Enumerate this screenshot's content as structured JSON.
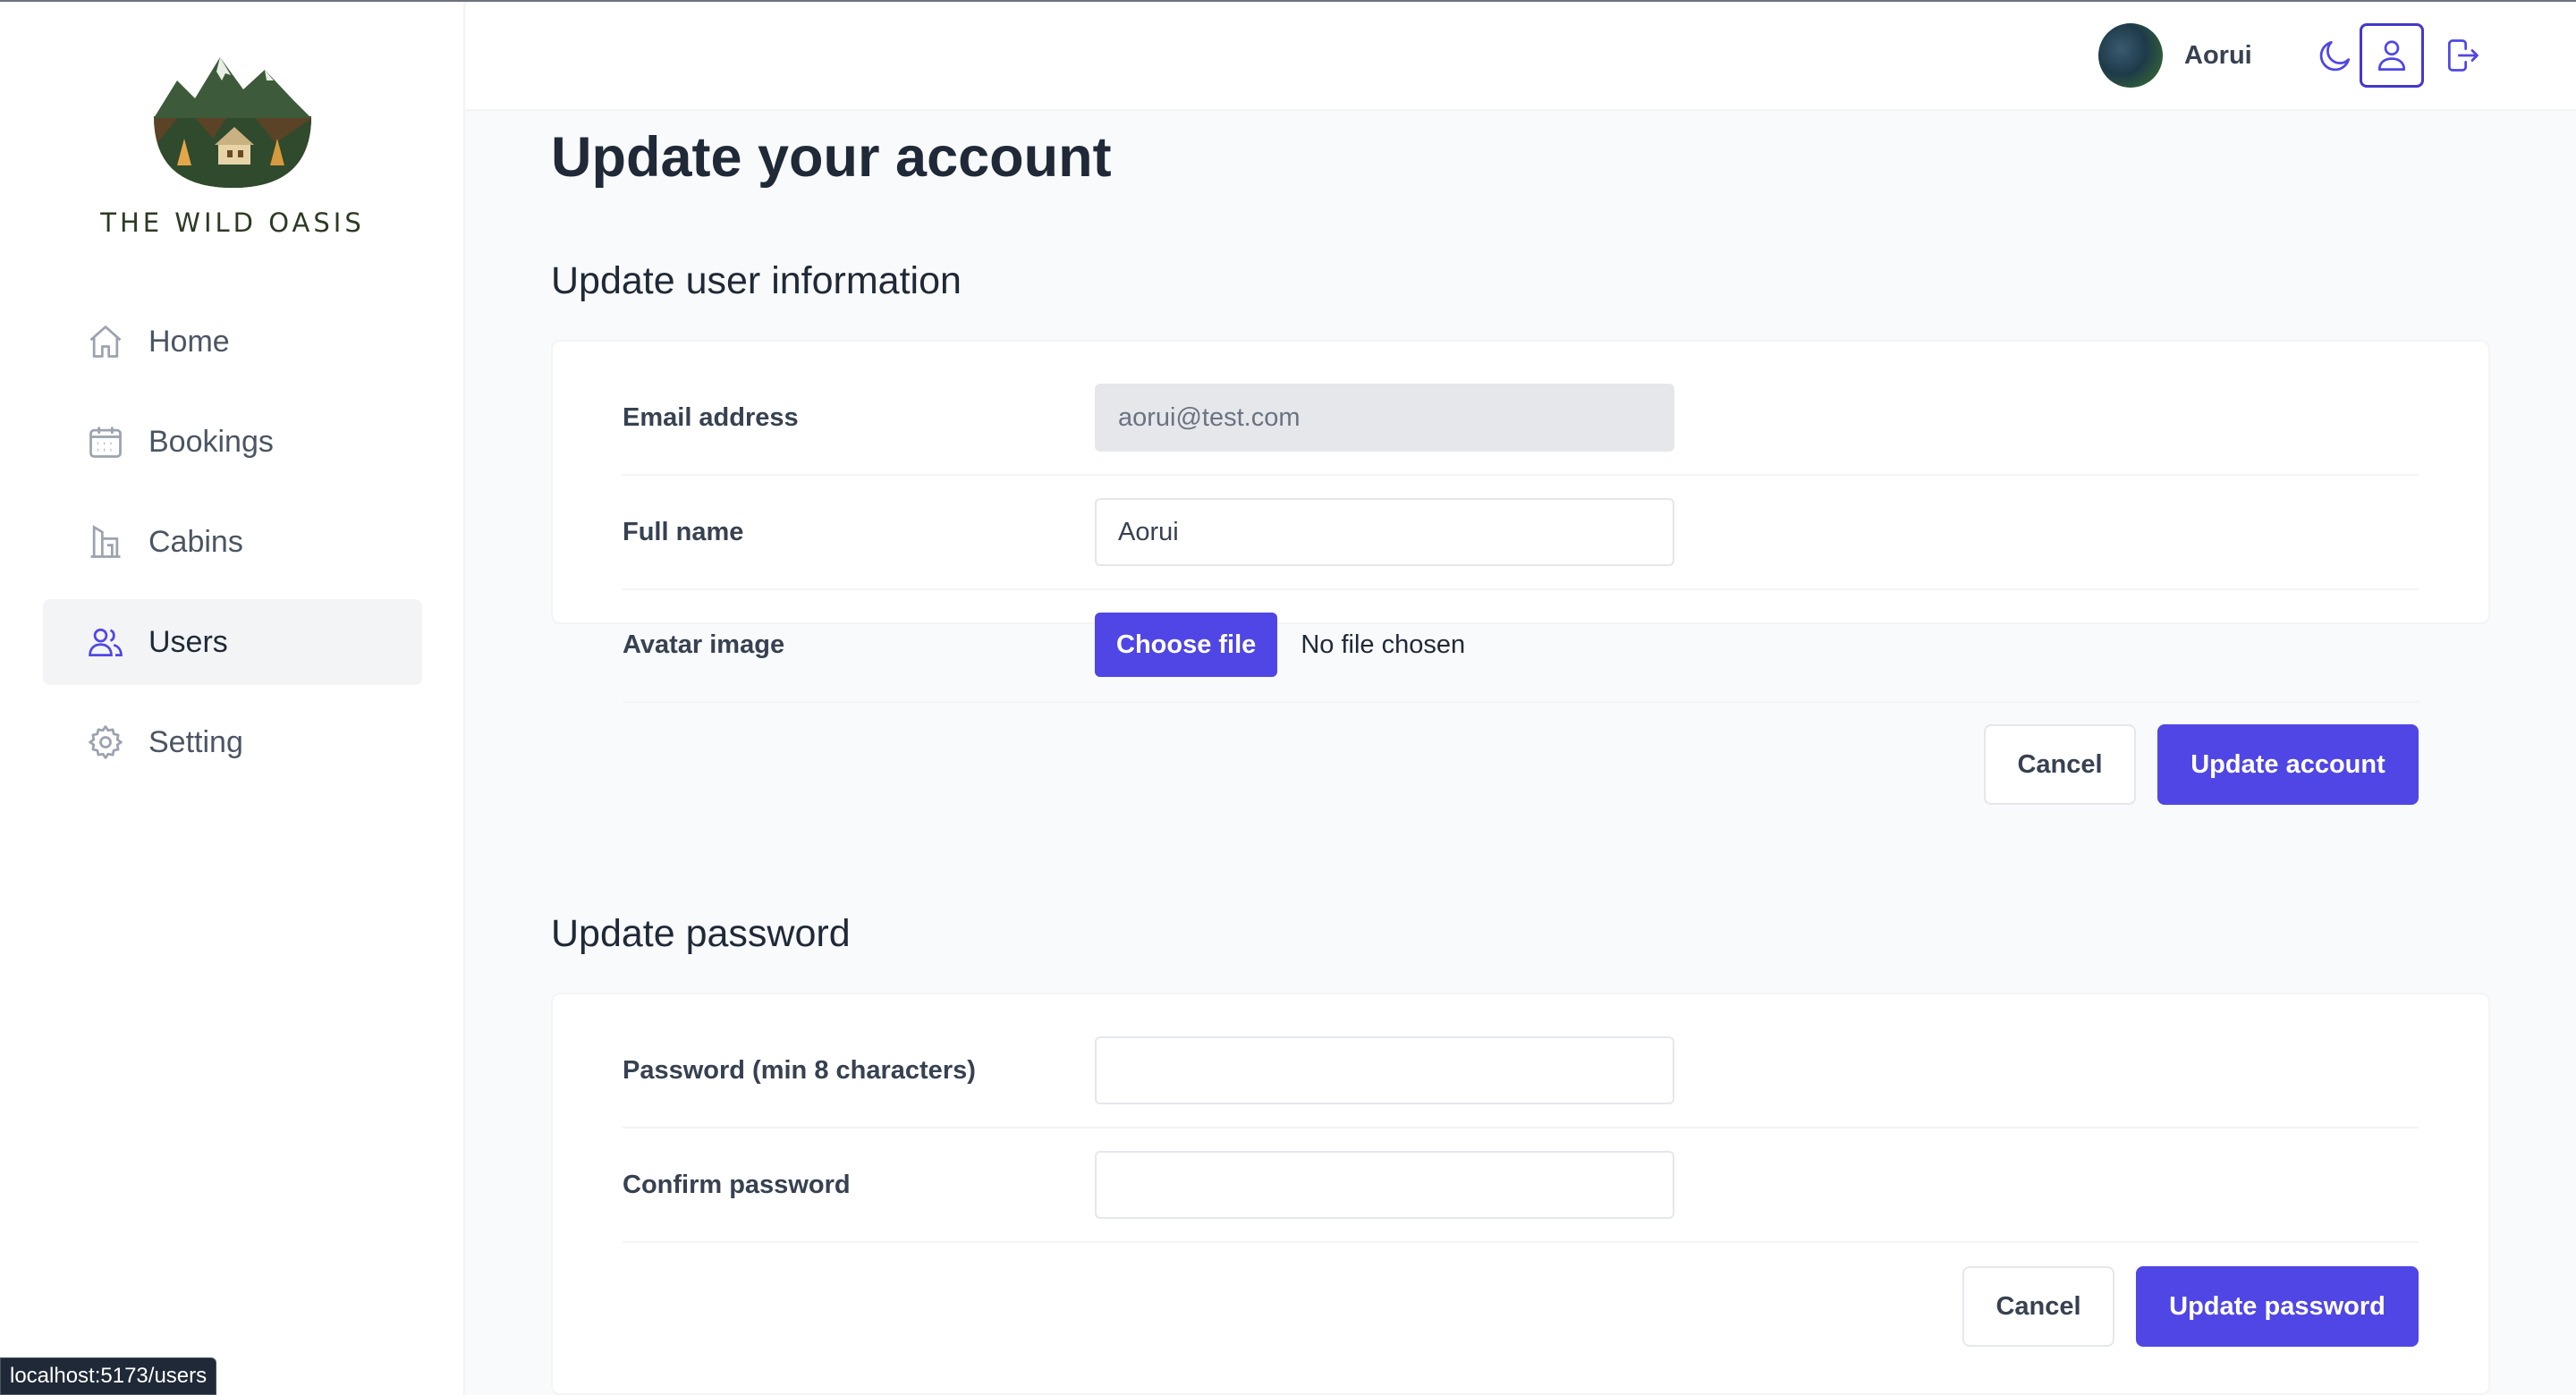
{
  "brand": {
    "name": "THE WILD OASIS"
  },
  "sidebar": {
    "items": [
      {
        "label": "Home",
        "icon": "home-icon",
        "active": false
      },
      {
        "label": "Bookings",
        "icon": "calendar-icon",
        "active": false
      },
      {
        "label": "Cabins",
        "icon": "building-icon",
        "active": false
      },
      {
        "label": "Users",
        "icon": "users-icon",
        "active": true
      },
      {
        "label": "Setting",
        "icon": "gear-icon",
        "active": false
      }
    ]
  },
  "header": {
    "username": "Aorui",
    "icons": [
      "moon-icon",
      "user-icon",
      "logout-icon"
    ]
  },
  "main": {
    "title": "Update your account",
    "user_section": {
      "title": "Update user information",
      "email_label": "Email address",
      "email_value": "aorui@test.com",
      "fullname_label": "Full name",
      "fullname_value": "Aorui",
      "avatar_label": "Avatar image",
      "choose_file_label": "Choose file",
      "file_status": "No file chosen",
      "cancel_label": "Cancel",
      "submit_label": "Update account"
    },
    "password_section": {
      "title": "Update password",
      "password_label": "Password (min 8 characters)",
      "password_value": "",
      "confirm_label": "Confirm password",
      "confirm_value": "",
      "cancel_label": "Cancel",
      "submit_label": "Update password"
    }
  },
  "status_bar": {
    "url": "localhost:5173/users"
  },
  "colors": {
    "accent": "#4f46e5",
    "background": "#f9fafb",
    "active_nav": "#f3f4f6"
  }
}
